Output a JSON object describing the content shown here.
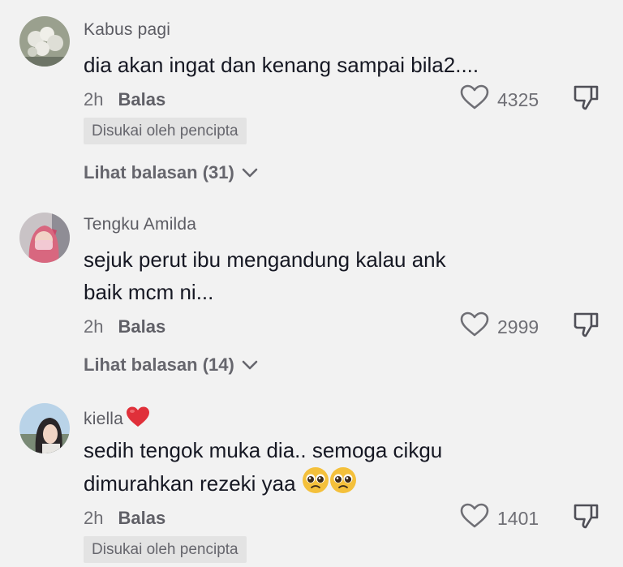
{
  "comments": [
    {
      "username": "Kabus pagi",
      "text": "dia akan ingat dan kenang sampai bila2....",
      "time": "2h",
      "reply_label": "Balas",
      "likes": "4325",
      "creator_badge": "Disukai oleh pencipta",
      "view_replies": "Lihat balasan (31)"
    },
    {
      "username": "Tengku Amilda",
      "text_line1": "sejuk perut ibu mengandung kalau ank",
      "text_line2": "baik mcm ni...",
      "time": "2h",
      "reply_label": "Balas",
      "likes": "2999",
      "view_replies": "Lihat balasan (14)"
    },
    {
      "username": "kiella",
      "text_line1": "sedih tengok muka dia.. semoga cikgu",
      "text_line2": "dimurahkan rezeki yaa",
      "time": "2h",
      "reply_label": "Balas",
      "likes": "1401",
      "creator_badge": "Disukai oleh pencipta"
    }
  ],
  "colors": {
    "background": "#f2f2f2",
    "text": "#161823",
    "muted": "#6f6f75",
    "badge_bg": "#e3e3e3",
    "heart_emoji": "#e0303a",
    "pleading_face": "#f4c03b"
  },
  "icons": [
    "heart-outline-icon",
    "thumbs-down-icon",
    "chevron-down-icon",
    "red-heart-emoji",
    "pleading-face-emoji"
  ]
}
